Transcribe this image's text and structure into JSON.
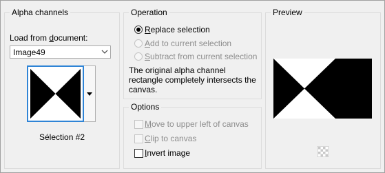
{
  "alpha": {
    "title": "Alpha channels",
    "load_label_pre": "Load from ",
    "load_label_u": "d",
    "load_label_post": "ocument:",
    "document_value": "Image49",
    "selection_name": "Sélection #2"
  },
  "operation": {
    "title": "Operation",
    "options": [
      {
        "u": "R",
        "rest": "eplace selection",
        "selected": true,
        "enabled": true
      },
      {
        "u": "A",
        "rest": "dd to current selection",
        "selected": false,
        "enabled": false
      },
      {
        "u": "S",
        "rest": "ubtract from current selection",
        "selected": false,
        "enabled": false
      }
    ],
    "description": "The original alpha channel rectangle completely intersects the canvas."
  },
  "options": {
    "title": "Options",
    "move": {
      "u": "M",
      "rest": "ove to upper left of canvas",
      "checked": false,
      "enabled": false
    },
    "clip": {
      "u": "C",
      "rest": "lip to canvas",
      "checked": false,
      "enabled": false
    },
    "invert": {
      "u": "I",
      "rest": "nvert image",
      "checked": false,
      "enabled": true
    }
  },
  "preview": {
    "title": "Preview"
  },
  "icons": {
    "dropdown": "chevron-down-icon",
    "thumbnail_dropdown": "triangle-down-icon",
    "transparency": "checkerboard-icon"
  },
  "colors": {
    "accent": "#2f84d6",
    "disabled_text": "#8d8d8d",
    "mask_black": "#000000",
    "mask_white": "#ffffff"
  }
}
